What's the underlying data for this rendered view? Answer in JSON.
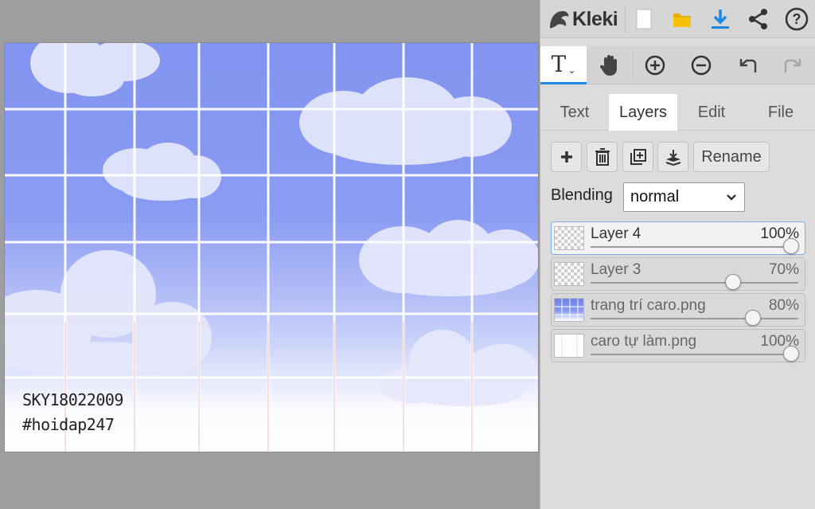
{
  "app": {
    "name": "Kleki"
  },
  "topbar": {
    "icons": [
      "new-file-icon",
      "open-folder-icon",
      "download-icon",
      "share-icon",
      "help-icon"
    ],
    "accent": "#1e88e5",
    "folder_color": "#f4c20d"
  },
  "toolbar": {
    "tools": [
      "text-tool",
      "hand-tool",
      "zoom-in",
      "zoom-out",
      "undo",
      "redo"
    ],
    "active": "text-tool"
  },
  "tabs": [
    {
      "label": "Text",
      "active": false
    },
    {
      "label": "Layers",
      "active": true
    },
    {
      "label": "Edit",
      "active": false
    },
    {
      "label": "File",
      "active": false
    }
  ],
  "layer_actions": {
    "rename_label": "Rename"
  },
  "blending": {
    "label": "Blending",
    "value": "normal"
  },
  "layers": [
    {
      "name": "Layer 4",
      "opacity": "100%",
      "opacity_value": 1.0,
      "active": true,
      "thumb": "checker"
    },
    {
      "name": "Layer 3",
      "opacity": "70%",
      "opacity_value": 0.7,
      "active": false,
      "thumb": "checker"
    },
    {
      "name": "trang trí caro.png",
      "opacity": "80%",
      "opacity_value": 0.8,
      "active": false,
      "thumb": "sky"
    },
    {
      "name": "caro tự làm.png",
      "opacity": "100%",
      "opacity_value": 1.0,
      "active": false,
      "thumb": "white"
    }
  ],
  "canvas": {
    "signature_line1": "SKY18022009",
    "signature_line2": "#hoidap247",
    "sky_top_color": "#8294f0",
    "sky_bottom_color": "#ffffff",
    "grid_color": "#ffffff"
  }
}
